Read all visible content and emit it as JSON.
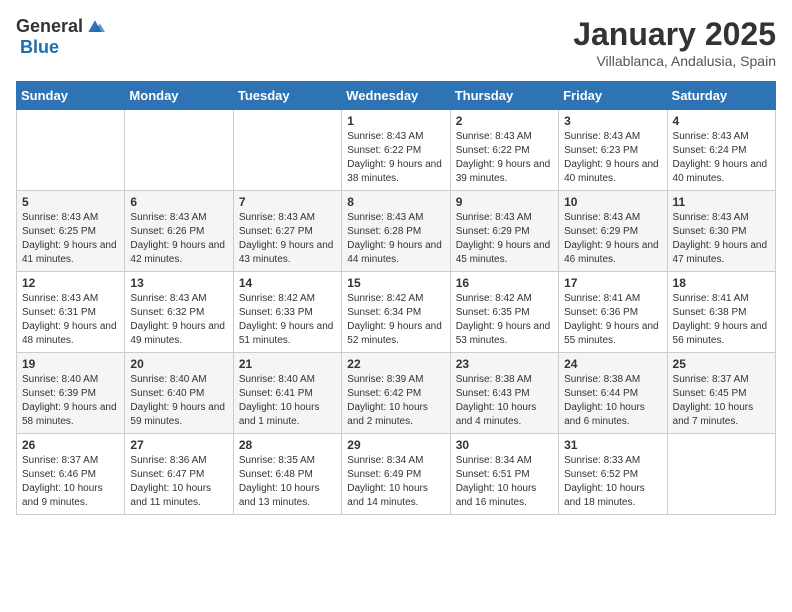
{
  "header": {
    "logo_general": "General",
    "logo_blue": "Blue",
    "month_title": "January 2025",
    "subtitle": "Villablanca, Andalusia, Spain"
  },
  "days_of_week": [
    "Sunday",
    "Monday",
    "Tuesday",
    "Wednesday",
    "Thursday",
    "Friday",
    "Saturday"
  ],
  "weeks": [
    [
      null,
      null,
      null,
      {
        "day": "1",
        "sunrise": "Sunrise: 8:43 AM",
        "sunset": "Sunset: 6:22 PM",
        "daylight": "Daylight: 9 hours and 38 minutes."
      },
      {
        "day": "2",
        "sunrise": "Sunrise: 8:43 AM",
        "sunset": "Sunset: 6:22 PM",
        "daylight": "Daylight: 9 hours and 39 minutes."
      },
      {
        "day": "3",
        "sunrise": "Sunrise: 8:43 AM",
        "sunset": "Sunset: 6:23 PM",
        "daylight": "Daylight: 9 hours and 40 minutes."
      },
      {
        "day": "4",
        "sunrise": "Sunrise: 8:43 AM",
        "sunset": "Sunset: 6:24 PM",
        "daylight": "Daylight: 9 hours and 40 minutes."
      }
    ],
    [
      {
        "day": "5",
        "sunrise": "Sunrise: 8:43 AM",
        "sunset": "Sunset: 6:25 PM",
        "daylight": "Daylight: 9 hours and 41 minutes."
      },
      {
        "day": "6",
        "sunrise": "Sunrise: 8:43 AM",
        "sunset": "Sunset: 6:26 PM",
        "daylight": "Daylight: 9 hours and 42 minutes."
      },
      {
        "day": "7",
        "sunrise": "Sunrise: 8:43 AM",
        "sunset": "Sunset: 6:27 PM",
        "daylight": "Daylight: 9 hours and 43 minutes."
      },
      {
        "day": "8",
        "sunrise": "Sunrise: 8:43 AM",
        "sunset": "Sunset: 6:28 PM",
        "daylight": "Daylight: 9 hours and 44 minutes."
      },
      {
        "day": "9",
        "sunrise": "Sunrise: 8:43 AM",
        "sunset": "Sunset: 6:29 PM",
        "daylight": "Daylight: 9 hours and 45 minutes."
      },
      {
        "day": "10",
        "sunrise": "Sunrise: 8:43 AM",
        "sunset": "Sunset: 6:29 PM",
        "daylight": "Daylight: 9 hours and 46 minutes."
      },
      {
        "day": "11",
        "sunrise": "Sunrise: 8:43 AM",
        "sunset": "Sunset: 6:30 PM",
        "daylight": "Daylight: 9 hours and 47 minutes."
      }
    ],
    [
      {
        "day": "12",
        "sunrise": "Sunrise: 8:43 AM",
        "sunset": "Sunset: 6:31 PM",
        "daylight": "Daylight: 9 hours and 48 minutes."
      },
      {
        "day": "13",
        "sunrise": "Sunrise: 8:43 AM",
        "sunset": "Sunset: 6:32 PM",
        "daylight": "Daylight: 9 hours and 49 minutes."
      },
      {
        "day": "14",
        "sunrise": "Sunrise: 8:42 AM",
        "sunset": "Sunset: 6:33 PM",
        "daylight": "Daylight: 9 hours and 51 minutes."
      },
      {
        "day": "15",
        "sunrise": "Sunrise: 8:42 AM",
        "sunset": "Sunset: 6:34 PM",
        "daylight": "Daylight: 9 hours and 52 minutes."
      },
      {
        "day": "16",
        "sunrise": "Sunrise: 8:42 AM",
        "sunset": "Sunset: 6:35 PM",
        "daylight": "Daylight: 9 hours and 53 minutes."
      },
      {
        "day": "17",
        "sunrise": "Sunrise: 8:41 AM",
        "sunset": "Sunset: 6:36 PM",
        "daylight": "Daylight: 9 hours and 55 minutes."
      },
      {
        "day": "18",
        "sunrise": "Sunrise: 8:41 AM",
        "sunset": "Sunset: 6:38 PM",
        "daylight": "Daylight: 9 hours and 56 minutes."
      }
    ],
    [
      {
        "day": "19",
        "sunrise": "Sunrise: 8:40 AM",
        "sunset": "Sunset: 6:39 PM",
        "daylight": "Daylight: 9 hours and 58 minutes."
      },
      {
        "day": "20",
        "sunrise": "Sunrise: 8:40 AM",
        "sunset": "Sunset: 6:40 PM",
        "daylight": "Daylight: 9 hours and 59 minutes."
      },
      {
        "day": "21",
        "sunrise": "Sunrise: 8:40 AM",
        "sunset": "Sunset: 6:41 PM",
        "daylight": "Daylight: 10 hours and 1 minute."
      },
      {
        "day": "22",
        "sunrise": "Sunrise: 8:39 AM",
        "sunset": "Sunset: 6:42 PM",
        "daylight": "Daylight: 10 hours and 2 minutes."
      },
      {
        "day": "23",
        "sunrise": "Sunrise: 8:38 AM",
        "sunset": "Sunset: 6:43 PM",
        "daylight": "Daylight: 10 hours and 4 minutes."
      },
      {
        "day": "24",
        "sunrise": "Sunrise: 8:38 AM",
        "sunset": "Sunset: 6:44 PM",
        "daylight": "Daylight: 10 hours and 6 minutes."
      },
      {
        "day": "25",
        "sunrise": "Sunrise: 8:37 AM",
        "sunset": "Sunset: 6:45 PM",
        "daylight": "Daylight: 10 hours and 7 minutes."
      }
    ],
    [
      {
        "day": "26",
        "sunrise": "Sunrise: 8:37 AM",
        "sunset": "Sunset: 6:46 PM",
        "daylight": "Daylight: 10 hours and 9 minutes."
      },
      {
        "day": "27",
        "sunrise": "Sunrise: 8:36 AM",
        "sunset": "Sunset: 6:47 PM",
        "daylight": "Daylight: 10 hours and 11 minutes."
      },
      {
        "day": "28",
        "sunrise": "Sunrise: 8:35 AM",
        "sunset": "Sunset: 6:48 PM",
        "daylight": "Daylight: 10 hours and 13 minutes."
      },
      {
        "day": "29",
        "sunrise": "Sunrise: 8:34 AM",
        "sunset": "Sunset: 6:49 PM",
        "daylight": "Daylight: 10 hours and 14 minutes."
      },
      {
        "day": "30",
        "sunrise": "Sunrise: 8:34 AM",
        "sunset": "Sunset: 6:51 PM",
        "daylight": "Daylight: 10 hours and 16 minutes."
      },
      {
        "day": "31",
        "sunrise": "Sunrise: 8:33 AM",
        "sunset": "Sunset: 6:52 PM",
        "daylight": "Daylight: 10 hours and 18 minutes."
      },
      null
    ]
  ]
}
